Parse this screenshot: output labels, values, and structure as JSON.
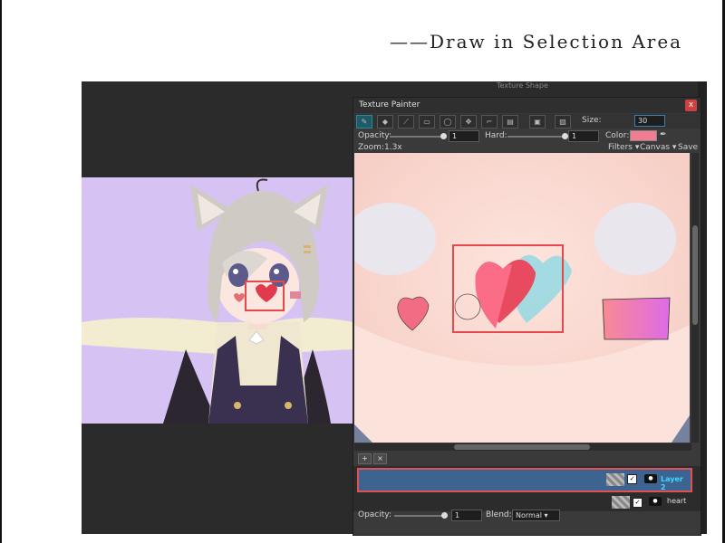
{
  "caption": "——Draw in Selection Area",
  "background_panel": {
    "text": "Texture Shape"
  },
  "painter": {
    "title": "Texture Painter",
    "close": "x",
    "tools": [
      {
        "icon": "brush-icon",
        "glyph": "✎"
      },
      {
        "icon": "fill-icon",
        "glyph": "◆"
      },
      {
        "icon": "eraser-icon",
        "glyph": "⟋"
      },
      {
        "icon": "rect-select-icon",
        "glyph": "▭"
      },
      {
        "icon": "lasso-icon",
        "glyph": "◯"
      },
      {
        "icon": "move-icon",
        "glyph": "✥"
      },
      {
        "icon": "crop-icon",
        "glyph": "⌐"
      },
      {
        "icon": "gradient-icon",
        "glyph": "▤"
      },
      {
        "icon": "stamp-icon",
        "glyph": "▣"
      },
      {
        "icon": "image-icon",
        "glyph": "▨"
      }
    ],
    "size_label": "Size:",
    "size_value": "30",
    "opacity_label": "Opacity:",
    "opacity_value": "1",
    "hard_label": "Hard:",
    "hard_value": "1",
    "color_label": "Color:",
    "color_value": "#f27c92",
    "zoom": "Zoom:1.3x",
    "filters_label": "Filters ▾",
    "canvas_label": "Canvas ▾",
    "save_label": "Save",
    "add_layer": "+",
    "remove_layer": "×",
    "layers": [
      {
        "name": "Layer 2",
        "selected": true
      },
      {
        "name": "heart",
        "selected": false
      }
    ],
    "layer_opacity_label": "Opacity:",
    "layer_opacity_value": "1",
    "blend_label": "Blend:",
    "blend_value": "Normal ▾"
  },
  "colors": {
    "accent": "#e5484d",
    "layer_selected": "#3d6490",
    "heart": "#e84a5f",
    "brush_color": "#f27c92"
  }
}
